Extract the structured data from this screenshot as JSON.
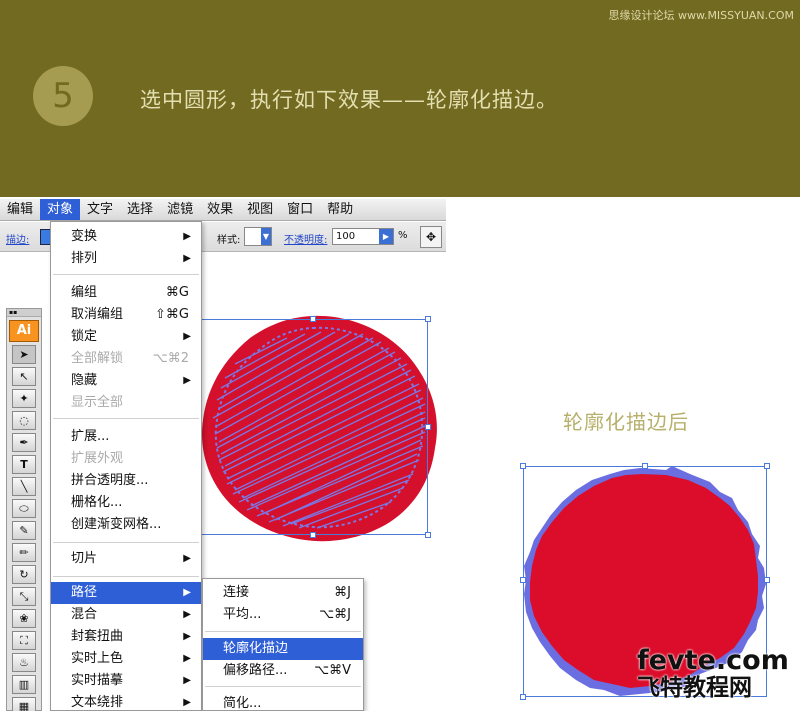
{
  "banner": {
    "step_number": "5",
    "instruction": "选中圆形，执行如下效果——轮廓化描边。",
    "watermark": "思缘设计论坛 www.MISSYUAN.COM"
  },
  "menubar": {
    "items": [
      "编辑",
      "对象",
      "文字",
      "选择",
      "滤镜",
      "效果",
      "视图",
      "窗口",
      "帮助"
    ]
  },
  "control_bar": {
    "stroke_label": "描边:",
    "style_label": "样式:",
    "opacity_label": "不透明度:",
    "opacity_value": "100",
    "percent": "%"
  },
  "tools": {
    "badge": "Ai",
    "type_tool": "T"
  },
  "object_menu": {
    "transform": "变换",
    "arrange": "排列",
    "group": "编组",
    "group_sc": "⌘G",
    "ungroup": "取消编组",
    "ungroup_sc": "⇧⌘G",
    "lock": "锁定",
    "unlock_all": "全部解锁",
    "unlock_all_sc": "⌥⌘2",
    "hide": "隐藏",
    "show_all": "显示全部",
    "expand": "扩展...",
    "expand_appearance": "扩展外观",
    "flatten_transparency": "拼合透明度...",
    "rasterize": "栅格化...",
    "gradient_mesh": "创建渐变网格...",
    "slice": "切片",
    "path": "路径",
    "blend": "混合",
    "envelope_distort": "封套扭曲",
    "live_paint": "实时上色",
    "live_trace": "实时描摹",
    "text_wrap": "文本绕排"
  },
  "path_menu": {
    "join": "连接",
    "join_sc": "⌘J",
    "average": "平均...",
    "average_sc": "⌥⌘J",
    "outline_stroke": "轮廓化描边",
    "offset_path": "偏移路径...",
    "offset_path_sc": "⌥⌘V",
    "simplify": "简化..."
  },
  "result": {
    "label": "轮廓化描边后"
  },
  "watermark_bottom": {
    "line1": "fevte.com",
    "line2": "飞特教程网"
  },
  "colors": {
    "banner": "#736a22",
    "fill_red": "#dc0d2b",
    "path_blue": "#6a6ee0",
    "menu_highlight": "#2f5fd6"
  }
}
